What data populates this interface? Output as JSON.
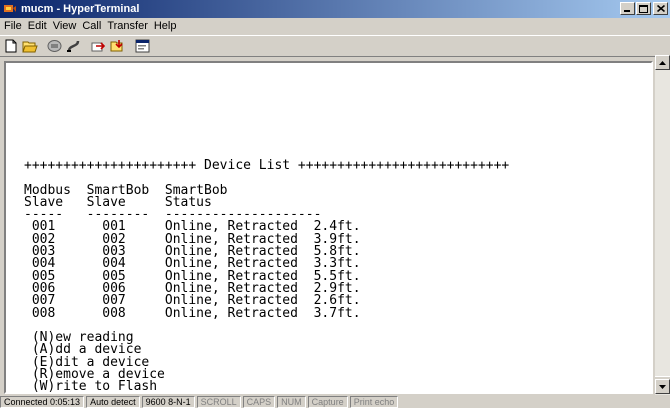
{
  "window": {
    "title": "mucm - HyperTerminal"
  },
  "menu": [
    "File",
    "Edit",
    "View",
    "Call",
    "Transfer",
    "Help"
  ],
  "toolbar": [
    {
      "name": "new-icon"
    },
    {
      "name": "open-icon"
    },
    {
      "name": "connect-icon"
    },
    {
      "name": "disconnect-icon"
    },
    {
      "name": "send-icon"
    },
    {
      "name": "receive-icon"
    },
    {
      "name": "properties-icon"
    }
  ],
  "terminal": {
    "lines": [
      "++++++++++++++++++++++ Device List +++++++++++++++++++++++++++",
      "",
      "Modbus  SmartBob  SmartBob",
      "Slave   Slave     Status",
      "-----   --------  --------------------",
      " 001      001     Online, Retracted  2.4ft.",
      " 002      002     Online, Retracted  3.9ft.",
      " 003      003     Online, Retracted  5.8ft.",
      " 004      004     Online, Retracted  3.3ft.",
      " 005      005     Online, Retracted  5.5ft.",
      " 006      006     Online, Retracted  2.9ft.",
      " 007      007     Online, Retracted  2.6ft.",
      " 008      008     Online, Retracted  3.7ft.",
      "",
      " (N)ew reading",
      " (A)dd a device",
      " (E)dit a device",
      " (R)emove a device",
      " (W)rite to Flash"
    ]
  },
  "status": {
    "connected": "Connected 0:05:13",
    "detect": "Auto detect",
    "settings": "9600 8-N-1",
    "scroll": "SCROLL",
    "caps": "CAPS",
    "num": "NUM",
    "capture": "Capture",
    "print": "Print echo"
  },
  "colors": {
    "titlebar_start": "#0a246a",
    "titlebar_end": "#a6caf0",
    "chrome": "#d4d0c8",
    "terminal_bg": "#ffffff"
  }
}
